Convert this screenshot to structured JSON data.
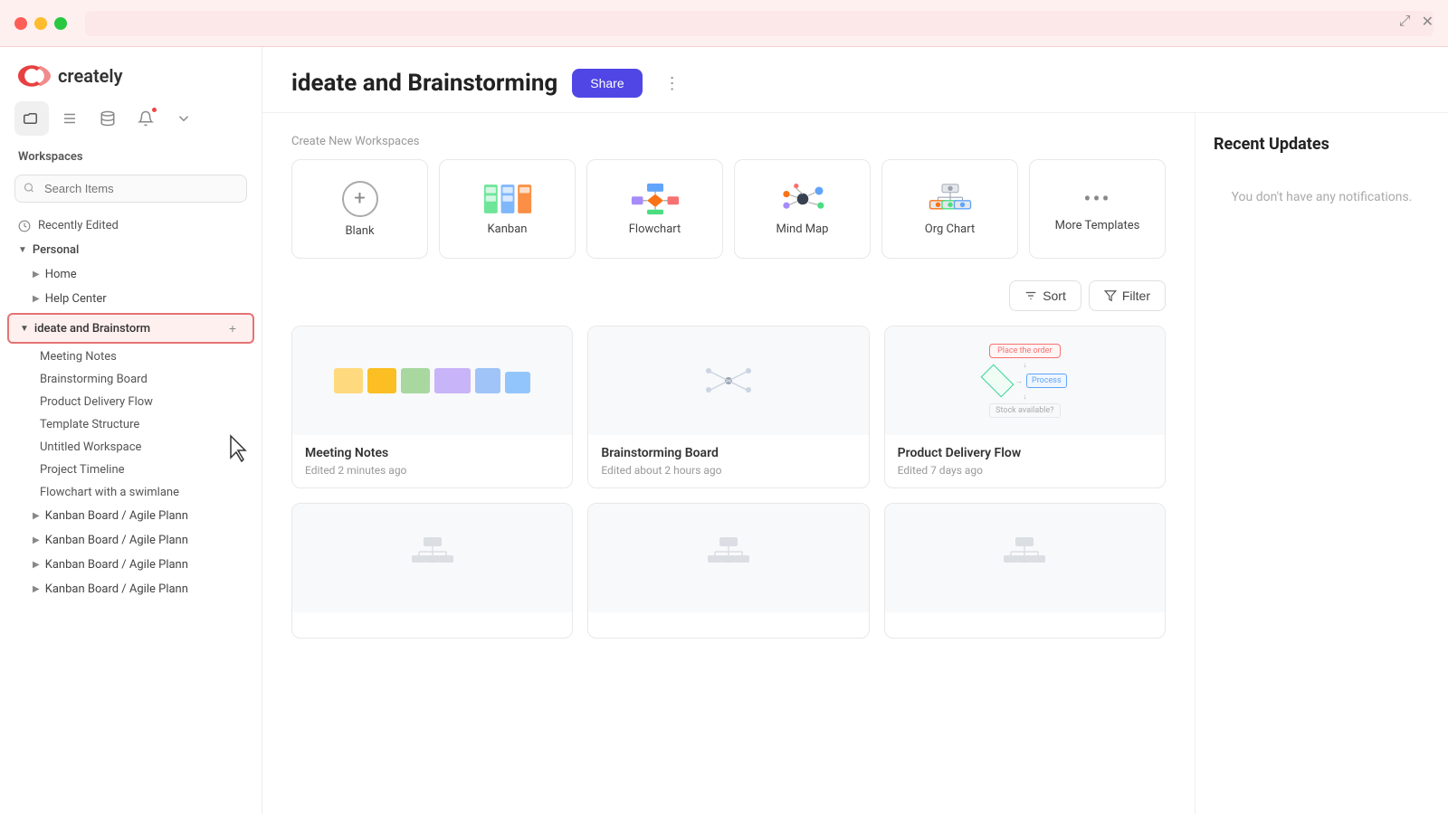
{
  "titlebar": {
    "dots": [
      "red",
      "yellow",
      "green"
    ]
  },
  "sidebar": {
    "logo_text": "creately",
    "icons": [
      {
        "name": "folder-icon",
        "symbol": "📁",
        "active": true
      },
      {
        "name": "list-icon",
        "symbol": "☰",
        "active": false
      },
      {
        "name": "database-icon",
        "symbol": "🗄",
        "active": false
      },
      {
        "name": "bell-icon",
        "symbol": "🔔",
        "active": false,
        "badge": true
      },
      {
        "name": "chevron-down-icon",
        "symbol": "⌄",
        "active": false
      }
    ],
    "workspaces_label": "Workspaces",
    "search_placeholder": "Search Items",
    "recently_edited": "Recently Edited",
    "nav_items": [
      {
        "label": "Personal",
        "type": "section",
        "expanded": true
      },
      {
        "label": "Home",
        "type": "child",
        "indent": 1
      },
      {
        "label": "Help Center",
        "type": "child",
        "indent": 1
      },
      {
        "label": "ideate and Brainstorm",
        "type": "child-active",
        "indent": 1
      },
      {
        "label": "Meeting Notes",
        "type": "sub",
        "indent": 2
      },
      {
        "label": "Brainstorming Board",
        "type": "sub",
        "indent": 2
      },
      {
        "label": "Product Delivery Flow",
        "type": "sub",
        "indent": 2
      },
      {
        "label": "Template Structure",
        "type": "sub",
        "indent": 2
      },
      {
        "label": "Untitled Workspace",
        "type": "sub",
        "indent": 2
      },
      {
        "label": "Project Timeline",
        "type": "sub",
        "indent": 2
      },
      {
        "label": "Flowchart with a swimlane",
        "type": "sub",
        "indent": 2
      },
      {
        "label": "Kanban Board / Agile Plann",
        "type": "child",
        "indent": 1
      },
      {
        "label": "Kanban Board / Agile Plann",
        "type": "child",
        "indent": 1
      },
      {
        "label": "Kanban Board / Agile Plann",
        "type": "child",
        "indent": 1
      },
      {
        "label": "Kanban Board / Agile Plann",
        "type": "child",
        "indent": 1
      }
    ]
  },
  "header": {
    "title": "ideate and Brainstorming",
    "share_label": "Share",
    "more_icon": "⋮"
  },
  "templates": {
    "section_label": "Create New Workspaces",
    "items": [
      {
        "id": "blank",
        "label": "Blank"
      },
      {
        "id": "kanban",
        "label": "Kanban"
      },
      {
        "id": "flowchart",
        "label": "Flowchart"
      },
      {
        "id": "mindmap",
        "label": "Mind Map"
      },
      {
        "id": "orgchart",
        "label": "Org Chart"
      },
      {
        "id": "more",
        "label": "More Templates"
      }
    ]
  },
  "controls": {
    "sort_label": "Sort",
    "filter_label": "Filter"
  },
  "workspaces": [
    {
      "name": "Meeting Notes",
      "edited": "Edited 2 minutes ago",
      "thumb": "meeting"
    },
    {
      "name": "Brainstorming Board",
      "edited": "Edited about 2 hours ago",
      "thumb": "brain"
    },
    {
      "name": "Product Delivery Flow",
      "edited": "Edited 7 days ago",
      "thumb": "flow"
    },
    {
      "name": "",
      "edited": "",
      "thumb": "blank"
    },
    {
      "name": "",
      "edited": "",
      "thumb": "blank"
    },
    {
      "name": "",
      "edited": "",
      "thumb": "blank"
    }
  ],
  "recent_updates": {
    "title": "Recent Updates",
    "empty_text": "You don't have any notifications."
  }
}
